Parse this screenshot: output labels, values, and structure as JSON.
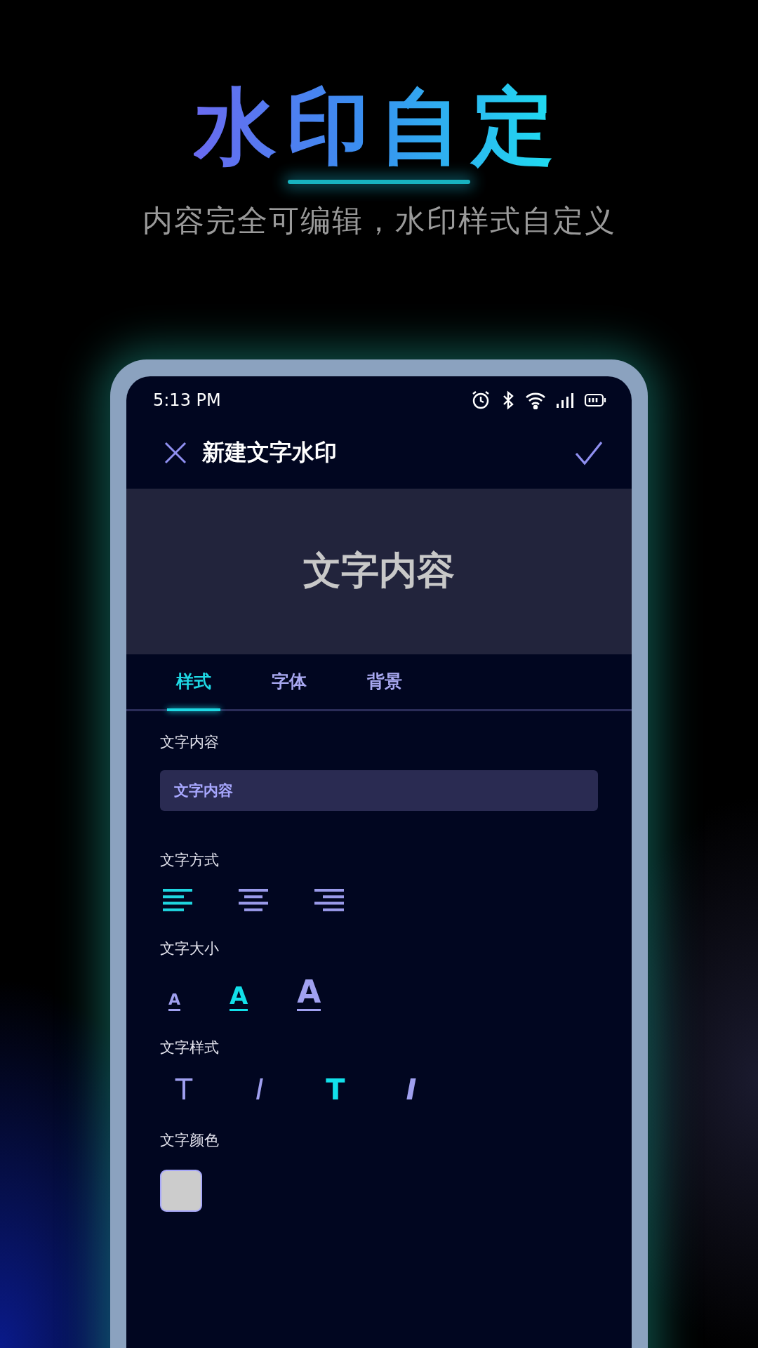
{
  "headline": "水印自定",
  "subtitle": "内容完全可编辑，水印样式自定义",
  "status_bar": {
    "time": "5:13 PM"
  },
  "app_bar": {
    "title": "新建文字水印"
  },
  "preview": {
    "text": "文字内容"
  },
  "tabs": [
    {
      "label": "样式",
      "selected": true
    },
    {
      "label": "字体",
      "selected": false
    },
    {
      "label": "背景",
      "selected": false
    }
  ],
  "content_section": {
    "label": "文字内容",
    "field_value": "文字内容"
  },
  "align_section": {
    "label": "文字方式",
    "options": [
      {
        "kind": "left",
        "selected": true
      },
      {
        "kind": "center",
        "selected": false
      },
      {
        "kind": "right",
        "selected": false
      }
    ]
  },
  "size_section": {
    "label": "文字大小",
    "options": [
      {
        "glyph": "A",
        "kind": "small",
        "selected": false
      },
      {
        "glyph": "A",
        "kind": "medium",
        "selected": true
      },
      {
        "glyph": "A",
        "kind": "large",
        "selected": false
      }
    ]
  },
  "style_section": {
    "label": "文字样式",
    "options": [
      {
        "glyph": "T",
        "kind": "normal",
        "selected": false
      },
      {
        "glyph": "I",
        "kind": "italic",
        "selected": false
      },
      {
        "glyph": "T",
        "kind": "bold",
        "selected": true
      },
      {
        "glyph": "I",
        "kind": "bold_italic",
        "selected": false
      }
    ]
  },
  "color_section": {
    "label": "文字颜色",
    "color": "#cccccc"
  }
}
